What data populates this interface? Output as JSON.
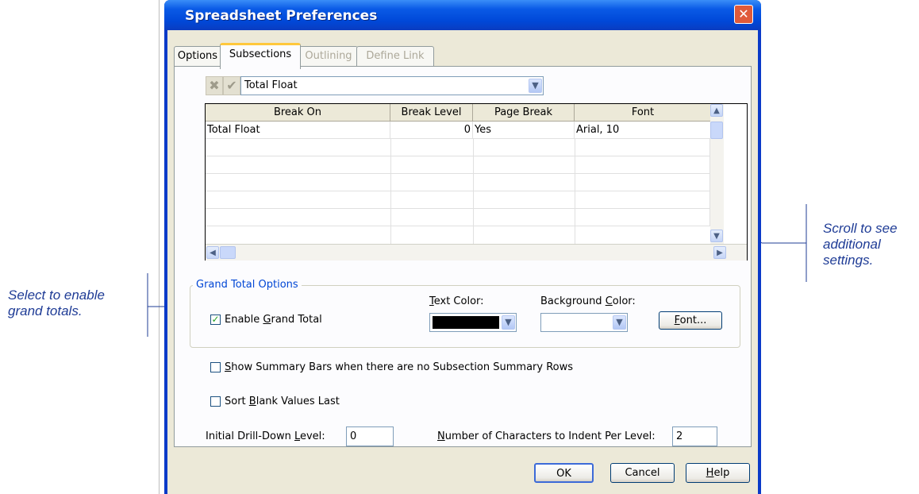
{
  "dialog": {
    "title": "Spreadsheet Preferences",
    "close_glyph": "✕"
  },
  "tabs": [
    {
      "label": "Options",
      "state": "normal"
    },
    {
      "label": "Subsections",
      "state": "active"
    },
    {
      "label": "Outlining",
      "state": "disabled"
    },
    {
      "label": "Define Link",
      "state": "disabled"
    }
  ],
  "toolbar": {
    "delete_glyph": "✖",
    "confirm_glyph": "✔",
    "subsection_value": "Total Float"
  },
  "grid": {
    "columns": [
      "Break On",
      "Break Level",
      "Page Break",
      "Font"
    ],
    "rows": [
      {
        "break_on": "Total Float",
        "break_level": "0",
        "page_break": "Yes",
        "font": "Arial, 10"
      }
    ]
  },
  "grand_total": {
    "legend": "Grand Total Options",
    "enable_label_pre": "Enable ",
    "enable_label_u": "G",
    "enable_label_post": "rand Total",
    "enable_checked": true,
    "text_color_u": "T",
    "text_color_rest": "ext Color:",
    "text_color_value": "#000000",
    "bg_color_pre": "Background ",
    "bg_color_u": "C",
    "bg_color_post": "olor:",
    "bg_color_value": "#ffffff",
    "font_btn_u": "F",
    "font_btn_rest": "ont..."
  },
  "options": {
    "summary_bars_u": "S",
    "summary_bars_rest": "how Summary Bars when there are no Subsection Summary Rows",
    "summary_bars_checked": false,
    "sort_blank_pre": "Sort ",
    "sort_blank_u": "B",
    "sort_blank_post": "lank Values Last",
    "sort_blank_checked": false,
    "drill_label_pre": "Initial Drill-Down ",
    "drill_label_u": "L",
    "drill_label_post": "evel:",
    "drill_value": "0",
    "indent_label_u": "N",
    "indent_label_rest": "umber of Characters to Indent Per Level:",
    "indent_value": "2"
  },
  "buttons": {
    "ok": "OK",
    "cancel": "Cancel",
    "help_u": "H",
    "help_rest": "elp"
  },
  "annotations": {
    "left": [
      "Select to enable",
      "grand totals."
    ],
    "right": [
      "Scroll to see",
      "additional",
      "settings."
    ]
  },
  "colors": {
    "annotation": "#1f3c96",
    "title_bar": "#0a5ae6",
    "dialog_face": "#ece9d8"
  }
}
